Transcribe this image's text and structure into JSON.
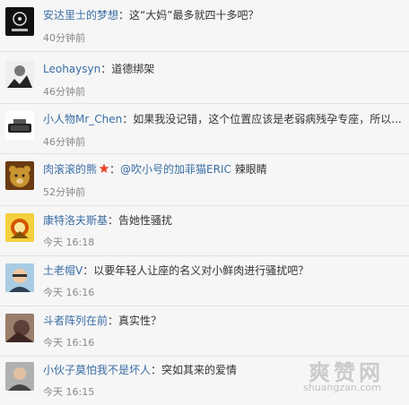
{
  "comments": [
    {
      "user": "安达里士的梦想",
      "sep": "：",
      "text": "这“大妈”最多就四十多吧？",
      "time": "40分钟前"
    },
    {
      "user": "Leohaysyn",
      "sep": "：",
      "text": "道德绑架",
      "time": "46分钟前"
    },
    {
      "user": "小人物Mr_Chen",
      "sep": "：",
      "text": "如果我没记错，这个位置应该是老弱病残孕专座，所以...",
      "time": "46分钟前"
    },
    {
      "user": "肉滚滚的熊",
      "sep": "：",
      "mention": "@吹小号的加菲猫ERIC",
      "text": " 辣眼睛",
      "time": "52分钟前"
    },
    {
      "user": "康特洛夫斯基",
      "sep": "：",
      "text": "告她性骚扰",
      "time": "今天 16:18"
    },
    {
      "user": "土老帽V",
      "sep": "：",
      "text": "以要年轻人让座的名义对小鲜肉进行骚扰吧？",
      "time": "今天 16:16"
    },
    {
      "user": "斗者阵列在前",
      "sep": "：",
      "text": "真实性？",
      "time": "今天 16:16"
    },
    {
      "user": "小伙子莫怕我不是坏人",
      "sep": "：",
      "text": "突如其来的爱情",
      "time": "今天 16:15"
    }
  ],
  "watermark": {
    "logo": "爽赞网",
    "url": "shuangzan.com"
  },
  "colors": {
    "username": "#3a6ea5",
    "time": "#888888",
    "badge": "#e8432d"
  }
}
